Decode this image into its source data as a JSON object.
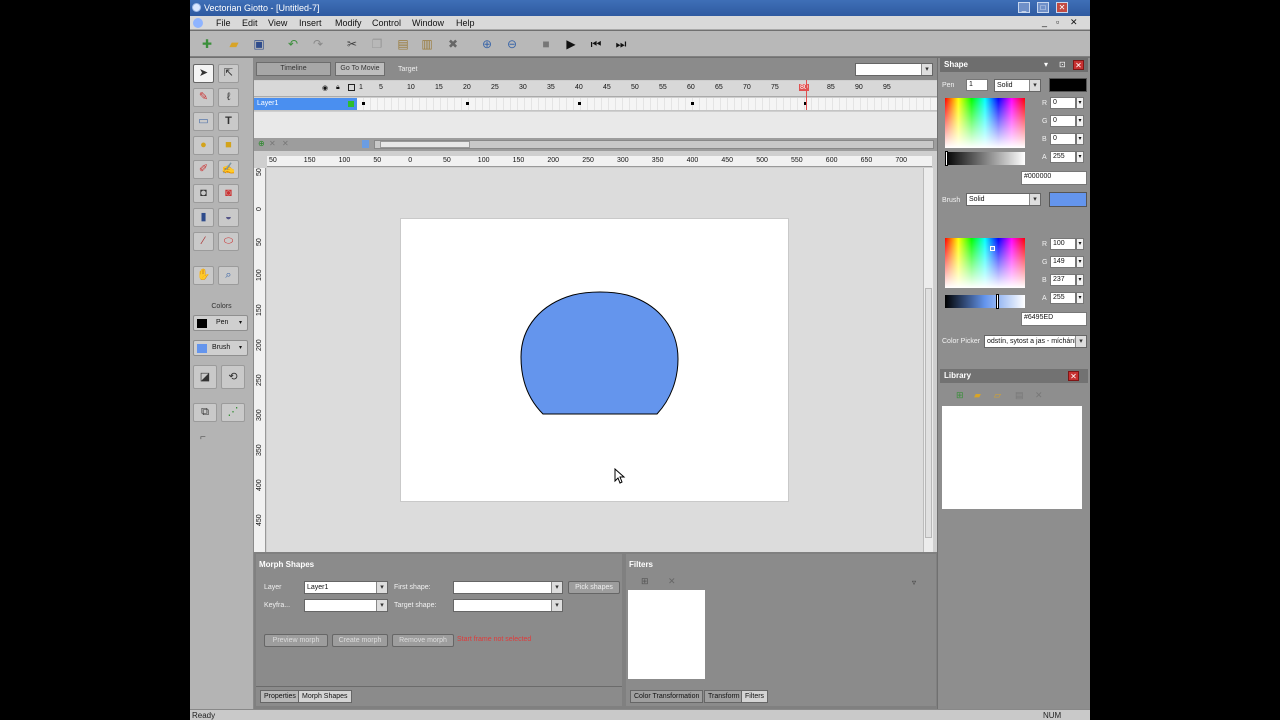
{
  "window": {
    "title": "Vectorian Giotto - [Untitled-7]",
    "controls": [
      "_",
      "□",
      "✕"
    ],
    "mdi_controls": [
      "_",
      "▫",
      "✕"
    ]
  },
  "menu": [
    "File",
    "Edit",
    "View",
    "Insert",
    "Modify",
    "Control",
    "Window",
    "Help"
  ],
  "toolbar": {
    "icons": [
      "new-icon",
      "open-icon",
      "save-icon",
      "undo-icon",
      "redo-icon",
      "cut-icon",
      "copy-icon",
      "paste-icon",
      "paste-special-icon",
      "delete-icon",
      "zoom-in-icon",
      "zoom-out-icon",
      "stop-icon",
      "play-icon",
      "rewind-icon",
      "forward-icon"
    ]
  },
  "tools": {
    "icons": [
      "arrow-icon",
      "subselect-icon",
      "pencil-icon",
      "lasso-icon",
      "line-icon",
      "text-icon",
      "ellipse-icon",
      "rectangle-icon",
      "pen-icon",
      "paint-icon",
      "transform-icon",
      "fill-transform-icon",
      "ink-bottle-icon",
      "paint-bucket-icon",
      "eyedropper-icon",
      "eraser-icon",
      "hand-icon",
      "zoom-icon"
    ],
    "colors_label": "Colors",
    "pen_label": "Pen",
    "brush_label": "Brush",
    "pen_color": "#000000",
    "brush_color": "#6495ED"
  },
  "timeline": {
    "tabs": [
      "Timeline",
      "Go To Movie"
    ],
    "target_label": "Target",
    "target_value": "",
    "frame_numbers": [
      "1",
      "5",
      "10",
      "15",
      "20",
      "25",
      "30",
      "35",
      "40",
      "45",
      "50",
      "55",
      "60",
      "65",
      "70",
      "75",
      "80",
      "85",
      "90",
      "95"
    ],
    "current_frame": "80",
    "layer": "Layer1"
  },
  "rulers": {
    "x": [
      "50",
      "150",
      "100",
      "50",
      "0",
      "50",
      "100",
      "150",
      "200",
      "250",
      "300",
      "350",
      "400",
      "450",
      "500",
      "550",
      "600",
      "650",
      "700"
    ],
    "y": [
      "50",
      "0",
      "50",
      "100",
      "150",
      "200",
      "250",
      "300",
      "350",
      "400",
      "450"
    ]
  },
  "stage": {
    "shape_fill": "#6495ED",
    "shape_stroke": "#000000"
  },
  "morph": {
    "title": "Morph Shapes",
    "layer_label": "Layer",
    "layer_value": "Layer1",
    "keyframe_label": "Keyfra...",
    "keyframe_value": "",
    "first_shape_label": "First shape:",
    "target_shape_label": "Target shape:",
    "pick_shapes": "Pick shapes",
    "buttons": [
      "Preview morph",
      "Create morph",
      "Remove morph"
    ],
    "status": "Start frame not selected",
    "tabs": [
      "Properties",
      "Morph Shapes"
    ]
  },
  "filters": {
    "title": "Filters",
    "tabs": [
      "Color Transformation",
      "Transform",
      "Filters"
    ]
  },
  "shape_panel": {
    "title": "Shape",
    "pen_label": "Pen",
    "pen_width": "1",
    "pen_style": "Solid",
    "pen_color": "#000000",
    "pen_rgb": {
      "R": "0",
      "G": "0",
      "B": "0",
      "A": "255"
    },
    "pen_hex": "#000000",
    "brush_label": "Brush",
    "brush_style": "Solid",
    "brush_color": "#6495ED",
    "brush_rgb": {
      "R": "100",
      "G": "149",
      "B": "237",
      "A": "255"
    },
    "brush_hex": "#6495ED",
    "picker_label": "Color Picker",
    "picker_value": "odstín, sytost a jas - míchání"
  },
  "library": {
    "title": "Library"
  },
  "status": {
    "left": "Ready",
    "right": "NUM"
  }
}
